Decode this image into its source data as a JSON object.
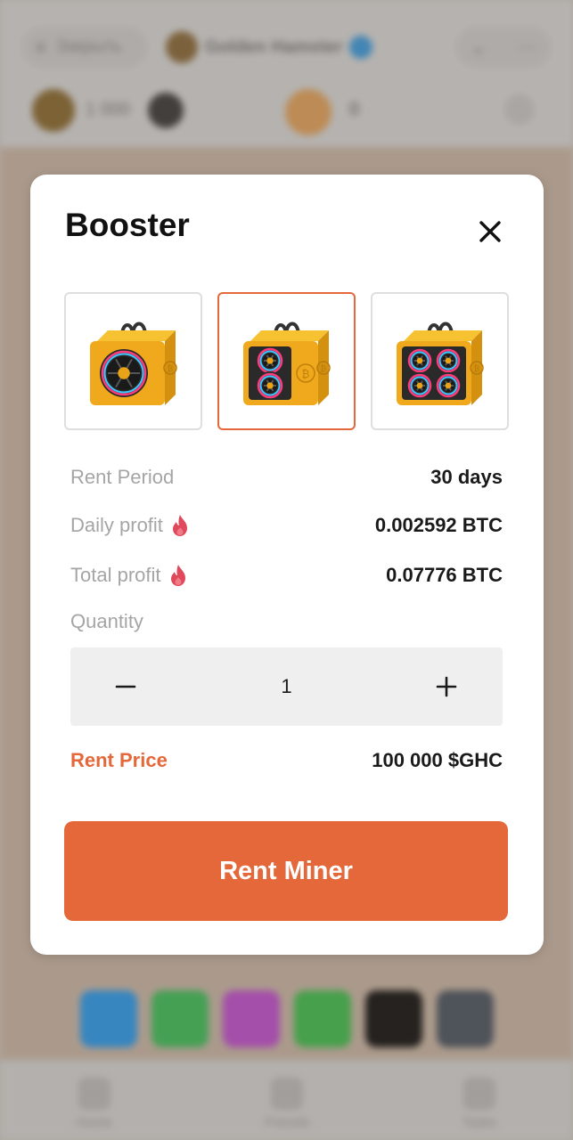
{
  "background": {
    "close_label": "Закрыть",
    "app_name": "Golden Hamster",
    "balance": "1 000",
    "btc_balance": "0",
    "tabs": [
      {
        "label": "Home"
      },
      {
        "label": "Friends"
      },
      {
        "label": "Tasks"
      }
    ],
    "socials": [
      {
        "name": "telegram-icon",
        "color": "#2a9bf0"
      },
      {
        "name": "whatsapp-icon",
        "color": "#3dbf5b"
      },
      {
        "name": "instagram-icon",
        "color": "#c14fd0"
      },
      {
        "name": "wechat-icon",
        "color": "#3fbf4f"
      },
      {
        "name": "x-icon",
        "color": "#111111"
      },
      {
        "name": "link-icon",
        "color": "#4b5563"
      }
    ]
  },
  "modal": {
    "title": "Booster",
    "close_icon": "close-icon",
    "options": [
      {
        "name": "miner-single-fan",
        "fans": 1,
        "selected": false
      },
      {
        "name": "miner-double-fan",
        "fans": 2,
        "selected": true
      },
      {
        "name": "miner-quad-fan",
        "fans": 4,
        "selected": false
      }
    ],
    "rent_period": {
      "label": "Rent Period",
      "value": "30 days"
    },
    "daily_profit": {
      "label": "Daily profit",
      "value": "0.002592 BTC",
      "icon": "flame-icon"
    },
    "total_profit": {
      "label": "Total profit",
      "value": "0.07776 BTC",
      "icon": "flame-icon"
    },
    "quantity": {
      "label": "Quantity",
      "value": "1",
      "minus_icon": "minus-icon",
      "plus_icon": "plus-icon"
    },
    "rent_price": {
      "label": "Rent Price",
      "value": "100 000 $GHC"
    },
    "rent_button": "Rent Miner"
  },
  "colors": {
    "accent": "#e4683a",
    "flame": "#e0485b",
    "stepper_bg": "#efefef"
  }
}
